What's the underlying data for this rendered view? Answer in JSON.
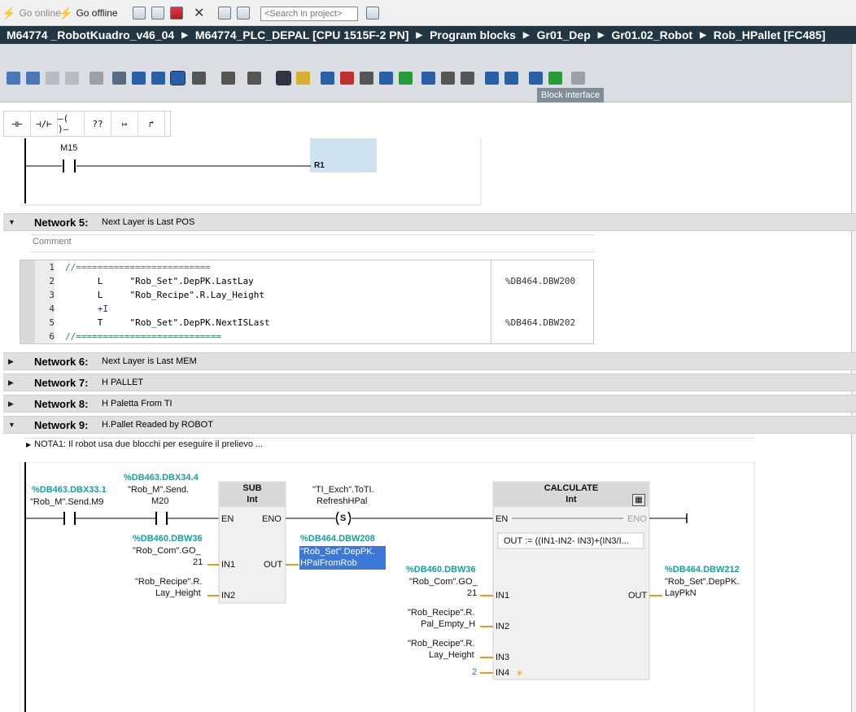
{
  "toolbar": {
    "go_online": "Go online",
    "go_offline": "Go offline",
    "search_placeholder": "<Search in project>"
  },
  "breadcrumb": [
    "M64774 _RobotKuadro_v46_04",
    "M64774_PLC_DEPAL [CPU 1515F-2 PN]",
    "Program blocks",
    "Gr01_Dep",
    "Gr01.02_Robot",
    "Rob_HPallet [FC485]"
  ],
  "block_interface": "Block interface",
  "ladder_palette": [
    "⊣⊢",
    "⊣/⊢",
    "–( )–",
    "??",
    "↦",
    "↱"
  ],
  "prev_network": {
    "contact": "M15",
    "coil": "R1"
  },
  "networks": {
    "n5": {
      "title": "Network 5:",
      "desc": "Next Layer is Last POS",
      "comment": "Comment"
    },
    "n6": {
      "title": "Network 6:",
      "desc": "Next Layer is Last MEM"
    },
    "n7": {
      "title": "Network 7:",
      "desc": "H PALLET"
    },
    "n8": {
      "title": "Network 8:",
      "desc": "H Paletta From TI"
    },
    "n9": {
      "title": "Network 9:",
      "desc": "H.Pallet  Readed by ROBOT",
      "note": "NOTA1: Il robot usa due blocchi per eseguire il prelievo ..."
    }
  },
  "code_lines": [
    {
      "n": "1",
      "text": "//=========================",
      "addr": ""
    },
    {
      "n": "2",
      "text": "      L     \"Rob_Set\".DepPK.LastLay",
      "addr": "%DB464.DBW200"
    },
    {
      "n": "3",
      "text": "      L     \"Rob_Recipe\".R.Lay_Height",
      "addr": ""
    },
    {
      "n": "4",
      "text": "      +I",
      "addr": ""
    },
    {
      "n": "5",
      "text": "      T     \"Rob_Set\".DepPK.NextISLast",
      "addr": "%DB464.DBW202"
    },
    {
      "n": "6",
      "text": "//===========================",
      "addr": ""
    }
  ],
  "fbd": {
    "c1_addr": "%DB463.DBX33.1",
    "c1_name": "\"Rob_M\".Send.M9",
    "c2_addr": "%DB463.DBX34.4",
    "c2_name1": "\"Rob_M\".Send.",
    "c2_name2": "M20",
    "sub_title": "SUB",
    "sub_type": "Int",
    "en": "EN",
    "eno": "ENO",
    "in1": "IN1",
    "in2": "IN2",
    "in3": "IN3",
    "in4": "IN4",
    "out": "OUT",
    "sub_in1_addr": "%DB460.DBW36",
    "sub_in1_n1": "\"Rob_Com\".GO_",
    "sub_in1_n2": "21",
    "sub_in2_n1": "\"Rob_Recipe\".R.",
    "sub_in2_n2": "Lay_Height",
    "sub_out_addr": "%DB464.DBW208",
    "sub_out_n1": "\"Rob_Set\".DepPK.",
    "sub_out_n2": "HPalFromRob",
    "coil_n1": "\"TI_Exch\".ToTI.",
    "coil_n2": "RefreshHPal",
    "coil_sym": "S",
    "calc_title": "CALCULATE",
    "calc_type": "Int",
    "calc_formula": "OUT :=   ((IN1-IN2- IN3)+(IN3/I...",
    "calc_in1_addr": "%DB460.DBW36",
    "calc_in1_n1": "\"Rob_Com\".GO_",
    "calc_in1_n2": "21",
    "calc_in2_n1": "\"Rob_Recipe\".R.",
    "calc_in2_n2": "Pal_Empty_H",
    "calc_in3_n1": "\"Rob_Recipe\".R.",
    "calc_in3_n2": "Lay_Height",
    "calc_in4": "2",
    "calc_out_addr": "%DB464.DBW212",
    "calc_out_n1": "\"Rob_Set\".DepPK.",
    "calc_out_n2": "LayPkN"
  }
}
